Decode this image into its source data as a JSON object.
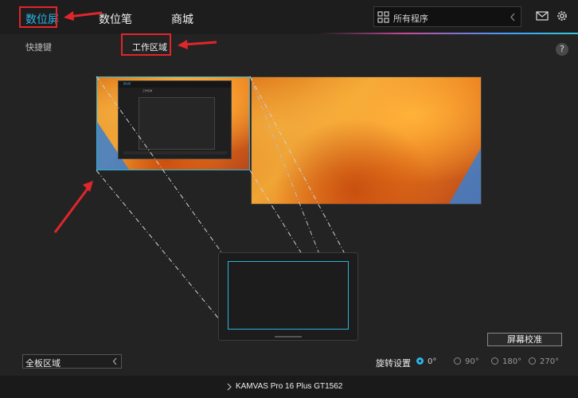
{
  "header": {
    "tabs": [
      {
        "label": "数位屏"
      },
      {
        "label": "数位笔"
      },
      {
        "label": "商城"
      }
    ],
    "search_placeholder": "所有程序"
  },
  "subtabs": [
    {
      "label": "快捷键"
    },
    {
      "label": "工作区域"
    }
  ],
  "help_label": "?",
  "mini_app": {
    "tab1": "数位屏",
    "tab2": "工作区域"
  },
  "calibrate_button": "屏幕校准",
  "area_select": {
    "value": "全板区域"
  },
  "rotation": {
    "label": "旋转设置",
    "options": [
      "0°",
      "90°",
      "180°",
      "270°"
    ],
    "selected": "0°"
  },
  "device": {
    "name": "KAMVAS Pro 16 Plus GT1562"
  },
  "colors": {
    "accent": "#29b6e8",
    "annotation": "#e0262b"
  }
}
